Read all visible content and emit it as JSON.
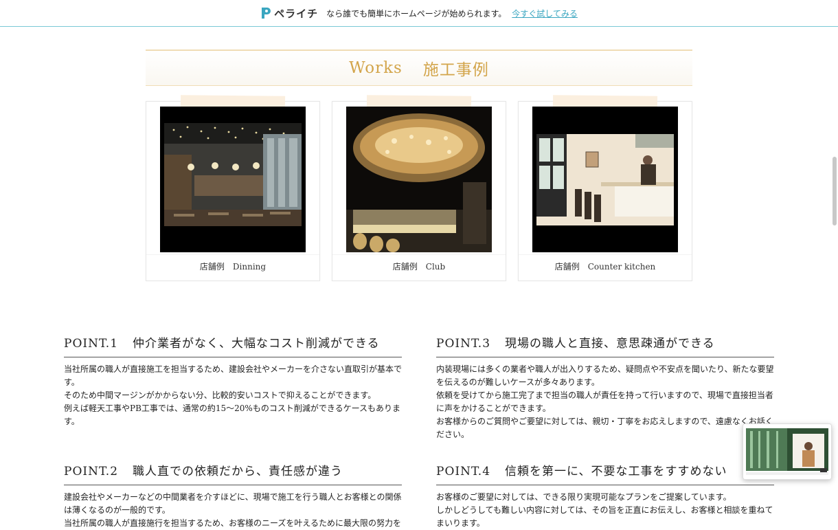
{
  "topbar": {
    "logo_text": "ペライチ",
    "tagline": "なら誰でも簡単にホームページが始められます。",
    "link": "今すぐ試してみる"
  },
  "section": {
    "title_en": "Works",
    "title_ja": "施工事例"
  },
  "works": [
    {
      "caption": "店舗例　Dinning"
    },
    {
      "caption": "店舗例　Club"
    },
    {
      "caption": "店舗例　Counter kitchen"
    }
  ],
  "points": [
    {
      "num": "POINT.1",
      "title": "仲介業者がなく、大幅なコスト削減ができる",
      "lines": [
        "当社所属の職人が直接施工を担当するため、建設会社やメーカーを介さない直取引が基本で",
        "す。",
        "そのため中間マージンがかからない分、比較的安いコストで抑えることができます。",
        "例えば軽天工事やPB工事では、通常の約15〜20%ものコスト削減ができるケースもありま",
        "す。"
      ]
    },
    {
      "num": "POINT.3",
      "title": "現場の職人と直接、意思疎通ができる",
      "lines": [
        "内装現場には多くの業者や職人が出入りするため、疑問点や不安点を聞いたり、新たな要望",
        "を伝えるのが難しいケースが多々あります。",
        "依頼を受けてから施工完了まで担当の職人が責任を持って行いますので、現場で直接担当者",
        "に声をかけることができます。",
        "お客様からのご質問やご要望に対しては、親切・丁寧をお応えしますので、遠慮なくお話く",
        "ださい。"
      ]
    },
    {
      "num": "POINT.2",
      "title": "職人直での依頼だから、責任感が違う",
      "lines": [
        "建設会社やメーカーなどの中間業者を介すほどに、現場で施工を行う職人とお客様との関係",
        "は薄くなるのが一般的です。",
        "当社所属の職人が直接施行を担当するため、お客様のニーズを叶えるために最大限の努力を"
      ]
    },
    {
      "num": "POINT.4",
      "title": "信頼を第一に、不要な工事をすすめない",
      "lines": [
        "お客様のご要望に対しては、できる限り実現可能なプランをご提案しています。",
        "しかしどうしても難しい内容に対しては、その旨を正直にお伝えし、お客様と相談を重ねて",
        "まいります。"
      ]
    }
  ],
  "colors": {
    "accent": "#d3a54b",
    "link": "#3aa6c0",
    "topbar_border": "#79c9d6"
  }
}
